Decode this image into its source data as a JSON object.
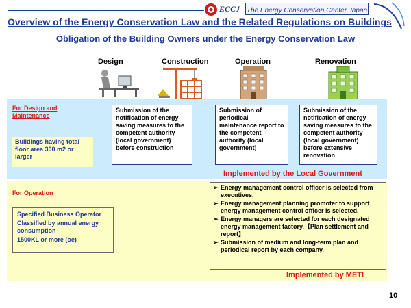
{
  "header": {
    "logo_text": "ECCJ",
    "center_name": "The Energy Conservation Center Japan",
    "title": "Overview of the Energy Conservation Law and the Related Regulations on Buildings",
    "subtitle": "Obligation of the Building Owners under the Energy Conservation Law"
  },
  "phases": {
    "design": "Design",
    "construction": "Construction",
    "operation": "Operation",
    "renovation": "Renovation"
  },
  "design_maintenance": {
    "label": "For Design and Maintenance",
    "requirement": "Buildings having total floor area 300 m2 or larger",
    "submission_construction": "Submission of the notification of  energy saving measures to the competent authority (local government) before construction",
    "submission_operation": "Submission of periodical maintenance report to the competent authority (local government)",
    "submission_renovation": "Submission of the notification of  energy saving measures to the competent authority (local government) before extensive renovation",
    "implemented_by": "Implemented by the Local Government"
  },
  "operation_section": {
    "label": "For Operation",
    "operator_lines": [
      "Specified Business Operator",
      "Classified by annual energy consumption",
      "1500KL or more (oe)"
    ],
    "bullets": [
      "Energy management control officer is selected from executives.",
      " Energy management planning promoter to support energy management control officer is selected.",
      "Energy managers are selected for each designated energy management factory.【Plan settlement and report】",
      "Submission of medium and long-term plan and periodical report by each company."
    ],
    "implemented_by": "Implemented by METI"
  },
  "page_number": "10",
  "colors": {
    "navy": "#1f3a93",
    "red": "#d21a1a",
    "band_blue": "#ccecfd",
    "band_yellow": "#fdfec6"
  }
}
